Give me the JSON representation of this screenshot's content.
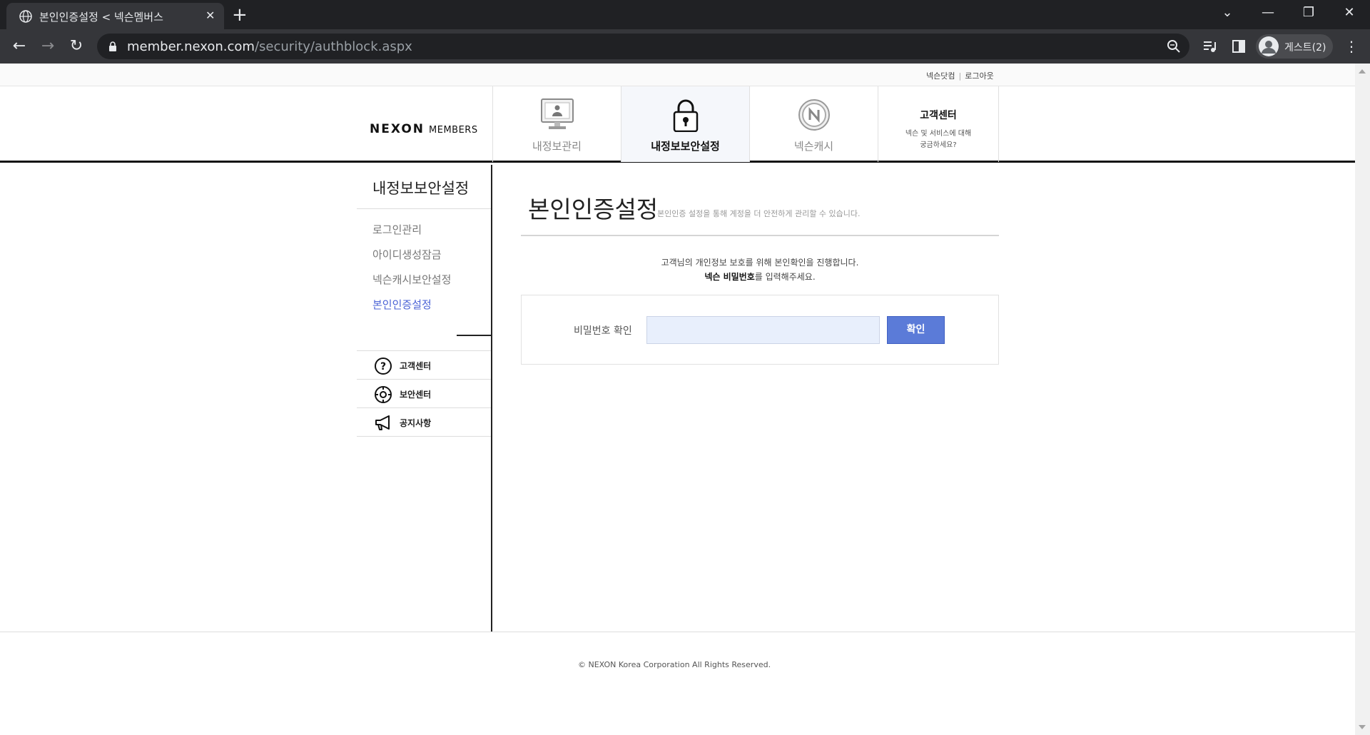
{
  "browser": {
    "tab": {
      "title": "본인인증설정 < 넥슨멤버스",
      "close": "✕"
    },
    "new_tab": "+",
    "window": {
      "menu": "⌄",
      "minimize": "—",
      "restore": "❐",
      "close": "✕"
    },
    "nav": {
      "back": "←",
      "forward": "→",
      "reload": "↻"
    },
    "url": {
      "host": "member.nexon.com",
      "path": "/security/authblock.aspx"
    },
    "profile": {
      "name": "게스트(2)"
    },
    "menu": "⋮"
  },
  "util": {
    "links": [
      "넥슨닷컴",
      "로그아웃"
    ],
    "separator": "|"
  },
  "header": {
    "logo": {
      "main": "NEXON",
      "sub": "MEMBERS"
    },
    "nav": [
      {
        "label": "내정보관리",
        "icon": "monitor-user-icon"
      },
      {
        "label": "내정보보안설정",
        "icon": "padlock-icon",
        "active": true
      },
      {
        "label": "넥슨캐시",
        "icon": "nexon-coin-icon"
      }
    ],
    "support": {
      "title": "고객센터",
      "desc_line1": "넥슨 및 서비스에 대해",
      "desc_line2": "궁금하세요?"
    }
  },
  "sidebar": {
    "title": "내정보보안설정",
    "menu": [
      "로그인관리",
      "아이디생성잠금",
      "넥슨캐시보안설정",
      "본인인증설정"
    ],
    "active_index": 3,
    "links": [
      {
        "label": "고객센터",
        "icon": "question-circle-icon"
      },
      {
        "label": "보안센터",
        "icon": "shield-target-icon"
      },
      {
        "label": "공지사항",
        "icon": "megaphone-icon"
      }
    ]
  },
  "main": {
    "title": "본인인증설정",
    "description": "본인인증 설정을 통해 계정을 더 안전하게 관리할 수 있습니다.",
    "notice_line1": "고객님의 개인정보 보호를 위해 본인확인을 진행합니다.",
    "notice_bold": "넥슨 비밀번호",
    "notice_line2_rest": "를 입력해주세요.",
    "password_label": "비밀번호 확인",
    "password_value": "",
    "confirm_button": "확인"
  },
  "footer": {
    "copyright": "© NEXON Korea Corporation All Rights Reserved."
  },
  "colors": {
    "accent": "#5b7bd8",
    "active_menu": "#4b63d6",
    "input_bg": "#e8effc"
  }
}
